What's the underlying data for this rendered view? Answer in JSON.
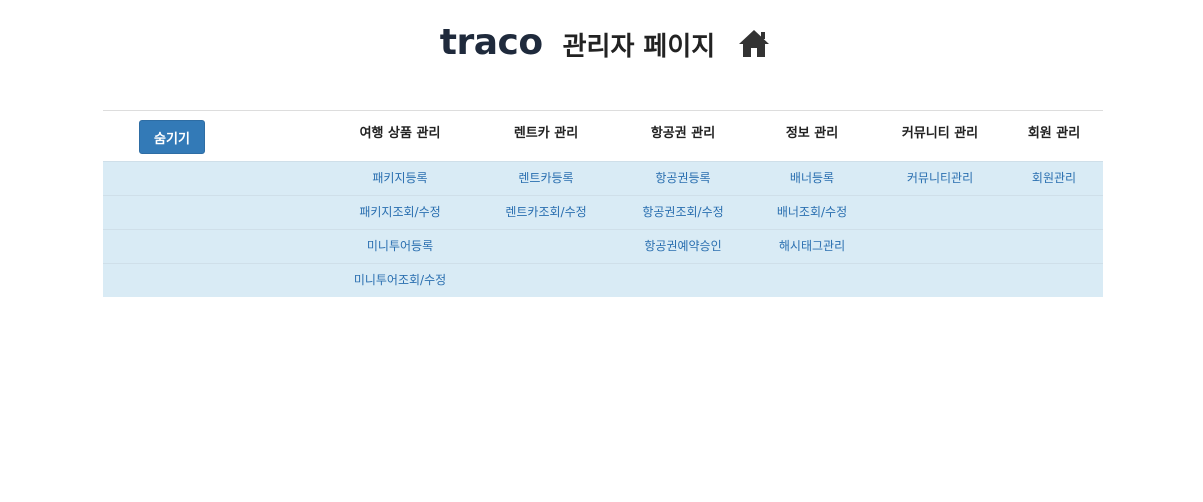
{
  "header": {
    "logo_text": "traco",
    "title": "관리자 페이지",
    "home_icon": "home-icon"
  },
  "menu": {
    "toggle_label": "숨기기",
    "columns": [
      {
        "label": "여행 상품 관리",
        "items": [
          "패키지등록",
          "패키지조회/수정",
          "미니투어등록",
          "미니투어조회/수정"
        ]
      },
      {
        "label": "렌트카 관리",
        "items": [
          "렌트카등록",
          "렌트카조회/수정"
        ]
      },
      {
        "label": "항공권 관리",
        "items": [
          "항공권등록",
          "항공권조회/수정",
          "항공권예약승인"
        ]
      },
      {
        "label": "정보 관리",
        "items": [
          "배너등록",
          "배너조회/수정",
          "해시태그관리"
        ]
      },
      {
        "label": "커뮤니티 관리",
        "items": [
          "커뮤니티관리"
        ]
      },
      {
        "label": "회원 관리",
        "items": [
          "회원관리"
        ]
      }
    ]
  },
  "colors": {
    "toggle_bg": "#337ab7",
    "submenu_bg": "#d9ebf5",
    "submenu_text": "#2a6fb0",
    "logo": "#1f2a3c"
  }
}
